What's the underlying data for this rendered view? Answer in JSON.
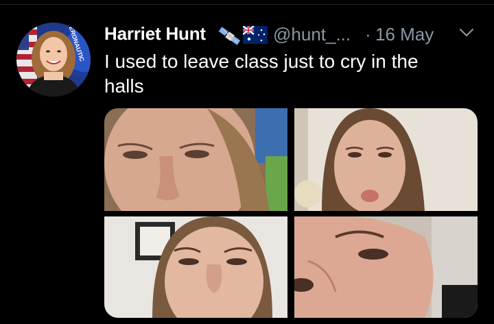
{
  "tweet": {
    "author_name": "Harriet Hunt",
    "author_emojis": [
      "satellite-emoji",
      "australia-flag-emoji"
    ],
    "handle": "@hunt_...",
    "separator": "·",
    "date": "16 May",
    "text": "I used to leave class just to cry in the halls",
    "avatar_badge_text": "ERONAUTIC",
    "media_count": 4
  },
  "colors": {
    "background": "#000000",
    "text": "#ffffff",
    "secondary_text": "#8899a6"
  },
  "icons": {
    "menu": "chevron-down-icon"
  }
}
